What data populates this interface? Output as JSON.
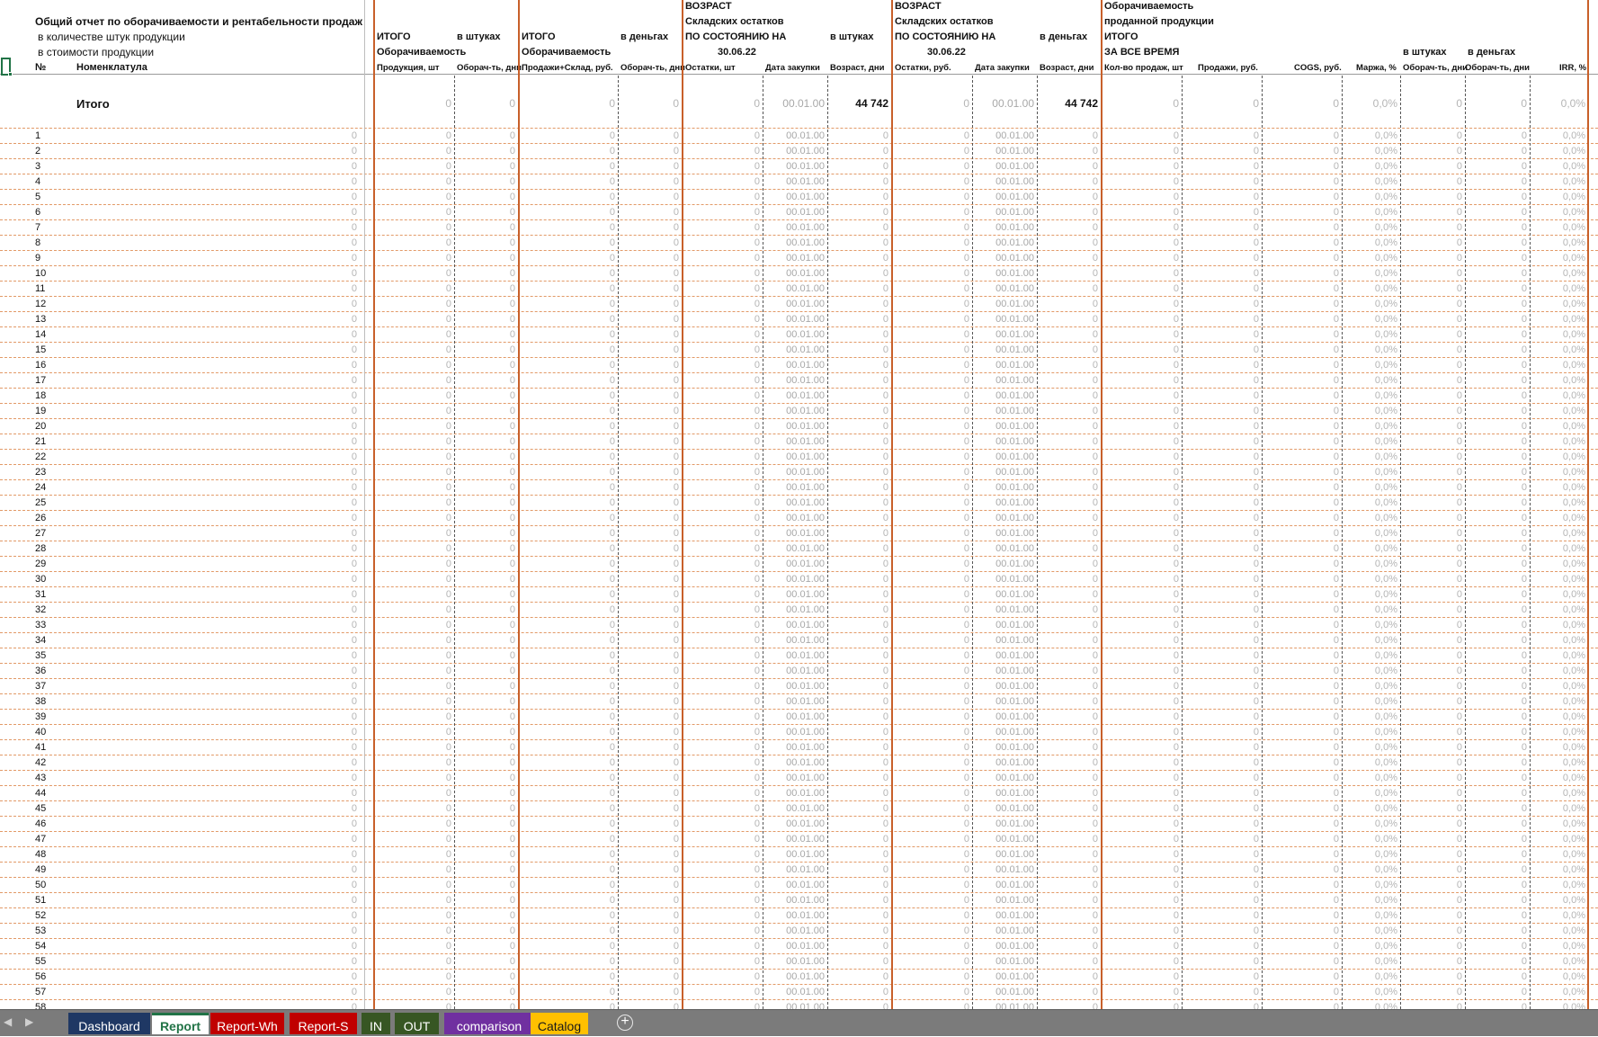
{
  "header": {
    "title": "Общий отчет по оборачиваемости и рентабельности продаж",
    "sub1": "в количестве штук продукции",
    "sub2": "в стоимости продукции",
    "col_no": "№",
    "col_nom": "Номенклатула",
    "g1_l1": "ИТОГО",
    "g1_l2": "Оборачиваемость",
    "g1_unit": "в штуках",
    "g1_c1": "Продукция, шт",
    "g1_c2": "Оборач-ть, дни",
    "g2_l1": "ИТОГО",
    "g2_l2": "Оборачиваемость",
    "g2_unit": "в деньгах",
    "g2_c1": "Продажи+Склад, руб.",
    "g2_c2": "Оборач-ть, дни",
    "g3_l1": "ВОЗРАСТ",
    "g3_l2": "Складских остатков",
    "g3_l3": "ПО СОСТОЯНИЮ НА",
    "g3_date": "30.06.22",
    "g3_unit": "в штуках",
    "g3_c1": "Остатки, шт",
    "g3_c2": "Дата закупки",
    "g3_c3": "Возраст, дни",
    "g4_l1": "ВОЗРАСТ",
    "g4_l2": "Складских остатков",
    "g4_l3": "ПО СОСТОЯНИЮ НА",
    "g4_date": "30.06.22",
    "g4_unit": "в деньгах",
    "g4_c1": "Остатки, руб.",
    "g4_c2": "Дата закупки",
    "g4_c3": "Возраст, дни",
    "g5_l1": "Оборачиваемость",
    "g5_l2": "проданной продукции",
    "g5_l3": "ИТОГО",
    "g5_l4": "ЗА ВСЕ ВРЕМЯ",
    "g5_unit1": "в штуках",
    "g5_unit2": "в деньгах",
    "g5_c1": "Кол-во продаж, шт",
    "g5_c2": "Продажи, руб.",
    "g5_c3": "COGS, руб.",
    "g5_c4": "Маржа, %",
    "g5_c5": "Оборач-ть, дни",
    "g5_c6": "Оборач-ть, дни",
    "g5_c7": "IRR, %"
  },
  "total": {
    "label": "Итого",
    "values": [
      "0",
      "0",
      "0",
      "0",
      "0",
      "00.01.00",
      "44 742",
      "0",
      "00.01.00",
      "44 742",
      "0",
      "0",
      "0",
      "0,0%",
      "0",
      "0",
      "0,0%"
    ]
  },
  "row_values": [
    "0",
    "0",
    "0",
    "0",
    "0",
    "0",
    "00.01.00",
    "0",
    "0",
    "00.01.00",
    "0",
    "0",
    "0",
    "0",
    "0,0%",
    "0",
    "0",
    "0,0%"
  ],
  "row_numbers": [
    "1",
    "2",
    "3",
    "4",
    "5",
    "6",
    "7",
    "8",
    "9",
    "10",
    "11",
    "12",
    "13",
    "14",
    "15",
    "16",
    "17",
    "18",
    "19",
    "20",
    "21",
    "22",
    "23",
    "24",
    "25",
    "26",
    "27",
    "28",
    "29",
    "30",
    "31",
    "32",
    "33",
    "34",
    "35",
    "36",
    "37",
    "38",
    "39",
    "40",
    "41",
    "42",
    "43",
    "44",
    "45",
    "46",
    "47",
    "48",
    "49",
    "50",
    "51",
    "52",
    "53",
    "54",
    "55",
    "56",
    "57",
    "58"
  ],
  "tabs": [
    {
      "label": "Dashboard",
      "color": "#1f3864",
      "active": false
    },
    {
      "label": "Report",
      "color": "#ffffff",
      "active": true
    },
    {
      "label": "Report-Wh",
      "color": "#c00000",
      "active": false
    },
    {
      "label": "Report-S",
      "color": "#c00000",
      "active": false
    },
    {
      "label": "IN",
      "color": "#375623",
      "active": false
    },
    {
      "label": "OUT",
      "color": "#375623",
      "active": false
    },
    {
      "label": "comparison",
      "color": "#7030a0",
      "active": false
    },
    {
      "label": "Catalog",
      "color": "#ffc000",
      "active": false
    }
  ],
  "tab_nav": {
    "prev": "◀",
    "next": "▶"
  },
  "add_sheet": "+"
}
